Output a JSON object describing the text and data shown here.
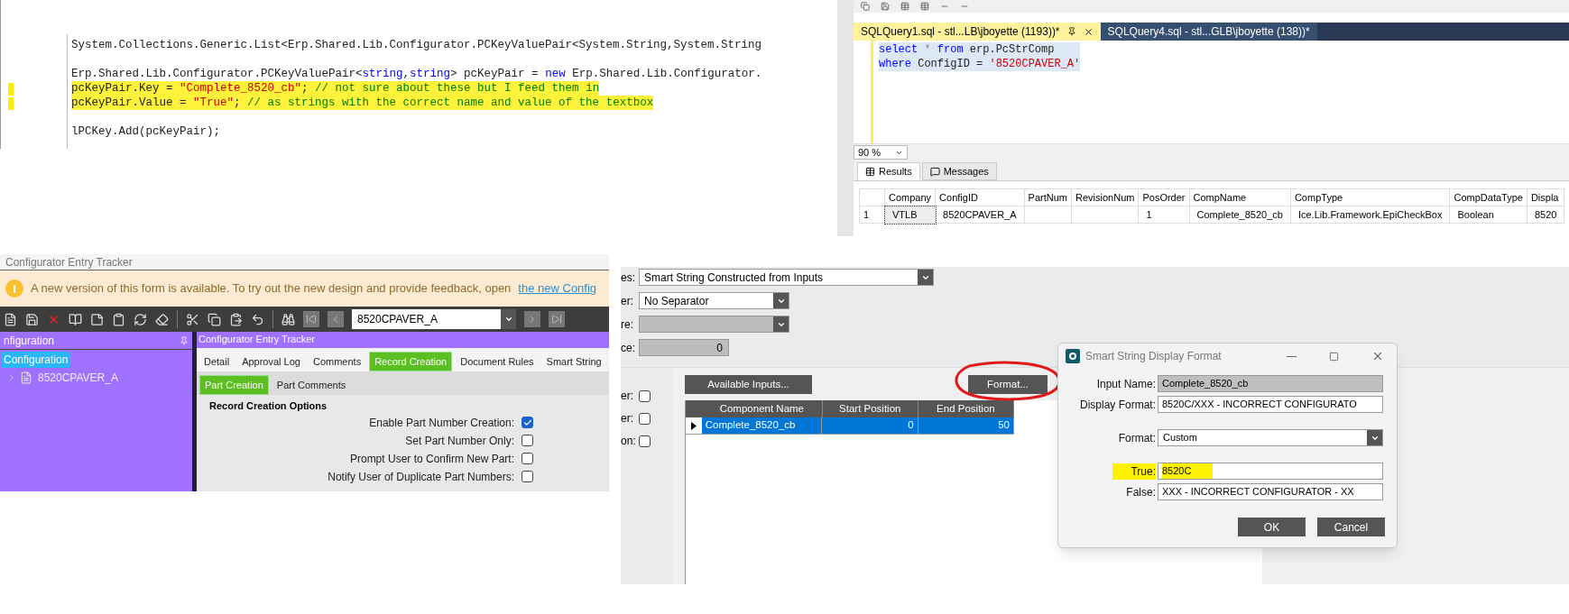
{
  "code_editor": {
    "lines": [
      {
        "highlighted": false,
        "gap_before": false,
        "tokens": [
          {
            "kind": "plain",
            "text": "System.Collections.Generic.List<Erp.Shared.Lib.Configurator.PCKeyValuePair<System.String,System.String"
          }
        ]
      },
      {
        "highlighted": false,
        "gap_before": true,
        "tokens": [
          {
            "kind": "plain",
            "text": "Erp.Shared.Lib.Configurator.PCKeyValuePair<"
          },
          {
            "kind": "keyword",
            "text": "string"
          },
          {
            "kind": "plain",
            "text": ","
          },
          {
            "kind": "keyword",
            "text": "string"
          },
          {
            "kind": "plain",
            "text": "> pcKeyPair = "
          },
          {
            "kind": "keyword",
            "text": "new"
          },
          {
            "kind": "plain",
            "text": " Erp.Shared.Lib.Configurator."
          }
        ]
      },
      {
        "highlighted": true,
        "gap_before": false,
        "tokens": [
          {
            "kind": "plain",
            "text": "pcKeyPair.Key = "
          },
          {
            "kind": "string",
            "text": "\"Complete_8520_cb\""
          },
          {
            "kind": "plain",
            "text": "; "
          },
          {
            "kind": "comment",
            "text": "// not sure about these but I feed them in"
          }
        ]
      },
      {
        "highlighted": true,
        "gap_before": false,
        "tokens": [
          {
            "kind": "plain",
            "text": "pcKeyPair.Value = "
          },
          {
            "kind": "string",
            "text": "\"True\""
          },
          {
            "kind": "plain",
            "text": "; "
          },
          {
            "kind": "comment",
            "text": "// as strings with the correct name and value of the textbox"
          }
        ]
      },
      {
        "highlighted": false,
        "gap_before": true,
        "tokens": [
          {
            "kind": "plain",
            "text": "lPCKey.Add(pcKeyPair);"
          }
        ]
      }
    ]
  },
  "sql_window": {
    "tabs": [
      {
        "label": "SQLQuery1.sql - stl...LB\\jboyette (1193))*",
        "selected": true
      },
      {
        "label": "SQLQuery4.sql - stl...GLB\\jboyette (138))*",
        "selected": false
      }
    ],
    "query_lines": [
      [
        {
          "kind": "keyword",
          "text": "select"
        },
        {
          "kind": "operator",
          "text": " * "
        },
        {
          "kind": "keyword",
          "text": "from"
        },
        {
          "kind": "plain",
          "text": " erp.PcStrComp"
        }
      ],
      [
        {
          "kind": "keyword",
          "text": "where"
        },
        {
          "kind": "plain",
          "text": " ConfigID = "
        },
        {
          "kind": "string",
          "text": "'8520CPAVER_A'"
        }
      ]
    ],
    "zoom": "90 %",
    "result_tabs": [
      {
        "label": "Results",
        "selected": true
      },
      {
        "label": "Messages",
        "selected": false
      }
    ],
    "results": {
      "columns": [
        "Company",
        "ConfigID",
        "PartNum",
        "RevisionNum",
        "PosOrder",
        "CompName",
        "CompType",
        "CompDataType",
        "Displa"
      ],
      "rows": [
        {
          "row_number": "1",
          "cells": [
            "VTLB",
            "8520CPAVER_A",
            null,
            null,
            "1",
            "Complete_8520_cb",
            "Ice.Lib.Framework.EpiCheckBox",
            "Boolean",
            "8520"
          ]
        }
      ]
    }
  },
  "entry_tracker": {
    "title": "Configurator Entry Tracker",
    "banner": {
      "text": "A new version of this form is available. To try out the new design and provide feedback, open",
      "link": "the new Config"
    },
    "key_field": "8520CPAVER_A",
    "tree_panel": {
      "title": "nfiguration",
      "items": [
        {
          "label": "Configuration",
          "selected": true,
          "children": [
            {
              "label": "8520CPAVER_A",
              "selected": false
            }
          ]
        }
      ]
    },
    "main_panel": {
      "title": "Configurator Entry Tracker",
      "tabs": [
        {
          "label": "Detail",
          "selected": false
        },
        {
          "label": "Approval Log",
          "selected": false
        },
        {
          "label": "Comments",
          "selected": false
        },
        {
          "label": "Record Creation",
          "selected": true
        },
        {
          "label": "Document Rules",
          "selected": false
        },
        {
          "label": "Smart String",
          "selected": false
        }
      ],
      "sub_tabs": [
        {
          "label": "Part Creation",
          "selected": true
        },
        {
          "label": "Part Comments",
          "selected": false
        }
      ],
      "group_title": "Record Creation Options",
      "options": [
        {
          "label": "Enable Part Number Creation:",
          "checked": true
        },
        {
          "label": "Set Part Number Only:",
          "checked": false
        },
        {
          "label": "Prompt User to Confirm New Part:",
          "checked": false
        },
        {
          "label": "Notify User of Duplicate Part Numbers:",
          "checked": false
        }
      ]
    }
  },
  "smart_string": {
    "fields": [
      {
        "label": "es:",
        "kind": "dropdown",
        "value": "Smart String Constructed from Inputs",
        "disabled": false
      },
      {
        "label": "er:",
        "kind": "dropdown",
        "value": "No Separator",
        "disabled": false
      },
      {
        "label": "re:",
        "kind": "dropdown",
        "disabled": true
      },
      {
        "label": "ce:",
        "kind": "number",
        "value": "0",
        "disabled": true
      }
    ],
    "checkboxes": [
      {
        "label": "er:",
        "checked": false
      },
      {
        "label": "er:",
        "checked": false
      },
      {
        "label": "on:",
        "checked": false
      }
    ],
    "buttons": [
      "Available Inputs...",
      "Format..."
    ],
    "grid": {
      "columns": [
        "Component Name",
        "Start Position",
        "End Position"
      ],
      "rows": [
        {
          "cells": [
            "Complete_8520_cb",
            "0",
            "50"
          ],
          "selected": true
        }
      ]
    }
  },
  "format_dialog": {
    "title": "Smart String Display Format",
    "fields": [
      {
        "label": "Input Name:",
        "value": "Complete_8520_cb",
        "kind": "readonly",
        "highlighted": false
      },
      {
        "label": "Display Format:",
        "value": "8520C/XXX - INCORRECT CONFIGURATO",
        "kind": "text",
        "highlighted": false
      },
      {
        "label": "Format:",
        "value": "Custom",
        "kind": "dropdown",
        "highlighted": false
      },
      {
        "label": "True:",
        "value": "8520C",
        "kind": "text",
        "highlighted": true
      },
      {
        "label": "False:",
        "value": "XXX - INCORRECT CONFIGURATOR - XX",
        "kind": "text",
        "highlighted": false
      }
    ],
    "buttons": [
      "OK",
      "Cancel"
    ]
  }
}
